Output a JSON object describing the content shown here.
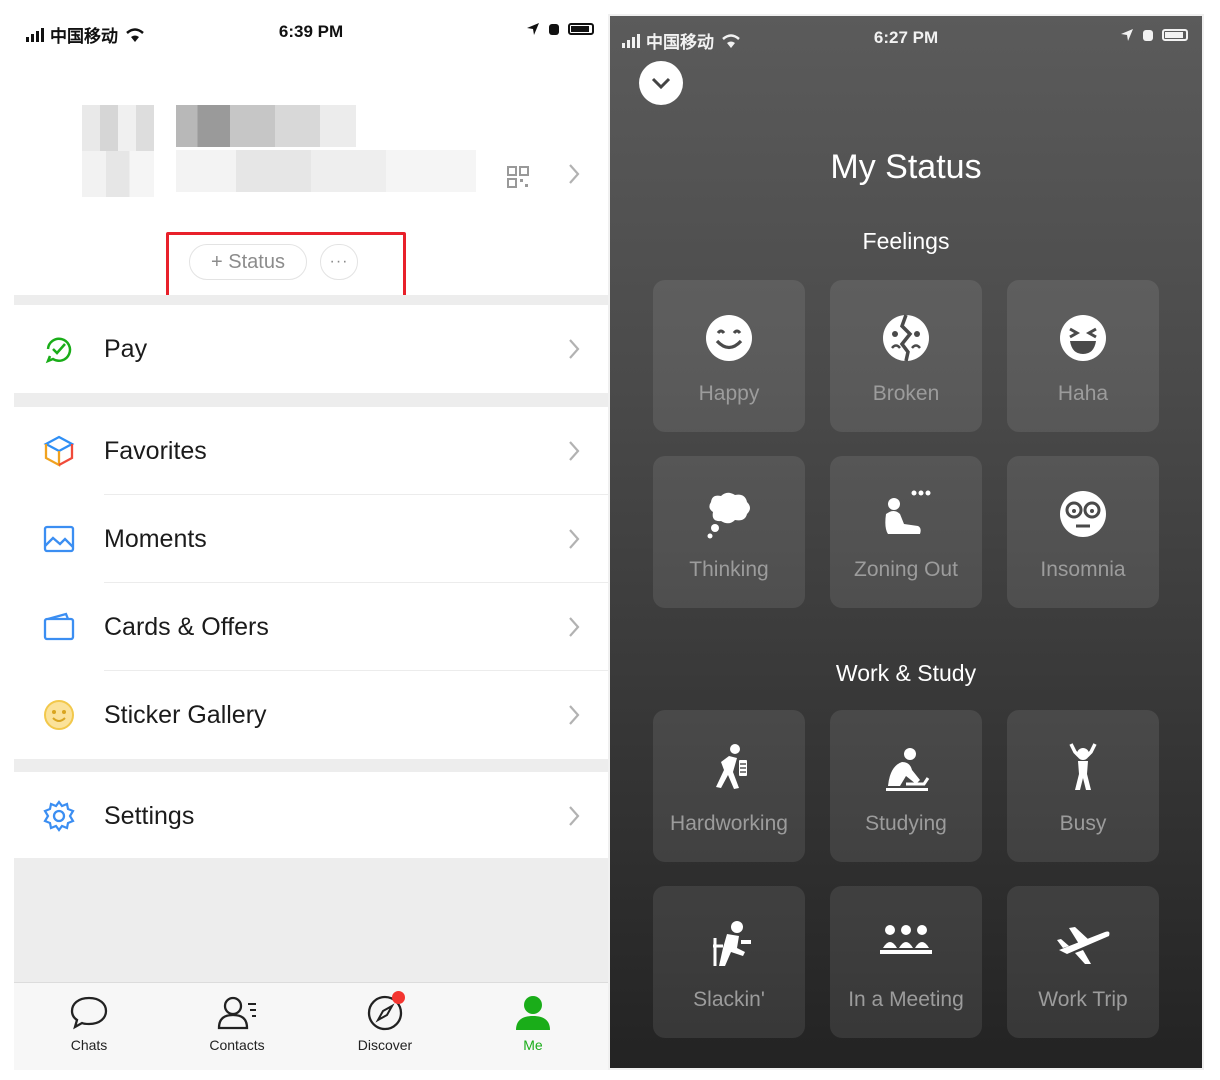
{
  "left_phone": {
    "status_bar": {
      "carrier": "中国移动",
      "time": "6:39 PM"
    },
    "profile": {
      "status_button": "+ Status",
      "more_button": "···"
    },
    "menu": {
      "pay": "Pay",
      "favorites": "Favorites",
      "moments": "Moments",
      "cards_offers": "Cards & Offers",
      "sticker_gallery": "Sticker Gallery",
      "settings": "Settings"
    },
    "tabs": {
      "chats": "Chats",
      "contacts": "Contacts",
      "discover": "Discover",
      "me": "Me"
    },
    "colors": {
      "accent_green": "#1aad19",
      "highlight_red": "#e8202a",
      "badge_red": "#f43530"
    }
  },
  "right_phone": {
    "status_bar": {
      "carrier": "中国移动",
      "time": "6:27 PM"
    },
    "title": "My Status",
    "feelings": {
      "heading": "Feelings",
      "items": [
        "Happy",
        "Broken",
        "Haha",
        "Thinking",
        "Zoning Out",
        "Insomnia"
      ]
    },
    "work_study": {
      "heading": "Work & Study",
      "items": [
        "Hardworking",
        "Studying",
        "Busy",
        "Slackin'",
        "In a Meeting",
        "Work Trip"
      ]
    }
  }
}
